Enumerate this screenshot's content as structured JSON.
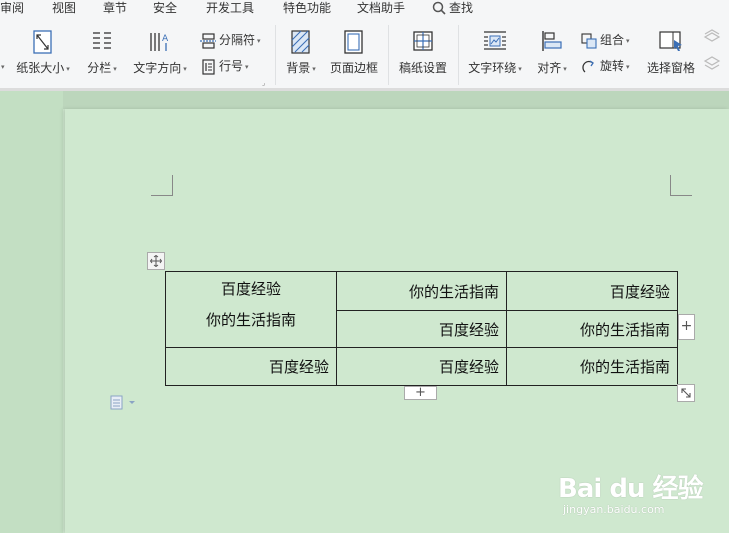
{
  "menu": {
    "tabs": [
      "审阅",
      "视图",
      "章节",
      "安全",
      "开发工具",
      "特色功能",
      "文档助手"
    ],
    "search_label": "查找"
  },
  "ribbon": {
    "paper_size": "纸张大小",
    "columns": "分栏",
    "text_direction": "文字方向",
    "separator": "分隔符",
    "line_number": "行号",
    "background": "背景",
    "page_border": "页面边框",
    "manuscript_setup": "稿纸设置",
    "text_wrap": "文字环绕",
    "align": "对齐",
    "group": "组合",
    "rotate": "旋转",
    "selection_pane": "选择窗格"
  },
  "table": {
    "rows": [
      [
        "百度经验",
        "你的生活指南",
        "百度经验"
      ],
      [
        "你的生活指南",
        "百度经验",
        "你的生活指南"
      ],
      [
        "百度经验",
        "百度经验",
        "你的生活指南"
      ]
    ]
  },
  "watermark": {
    "logo_text": "Bai du 经验",
    "url": "jingyan.baidu.com"
  },
  "colors": {
    "eye_protection_green": "#cfe8cf",
    "ribbon_bg": "#f5f6f7",
    "accent_blue": "#3b6fb6"
  }
}
